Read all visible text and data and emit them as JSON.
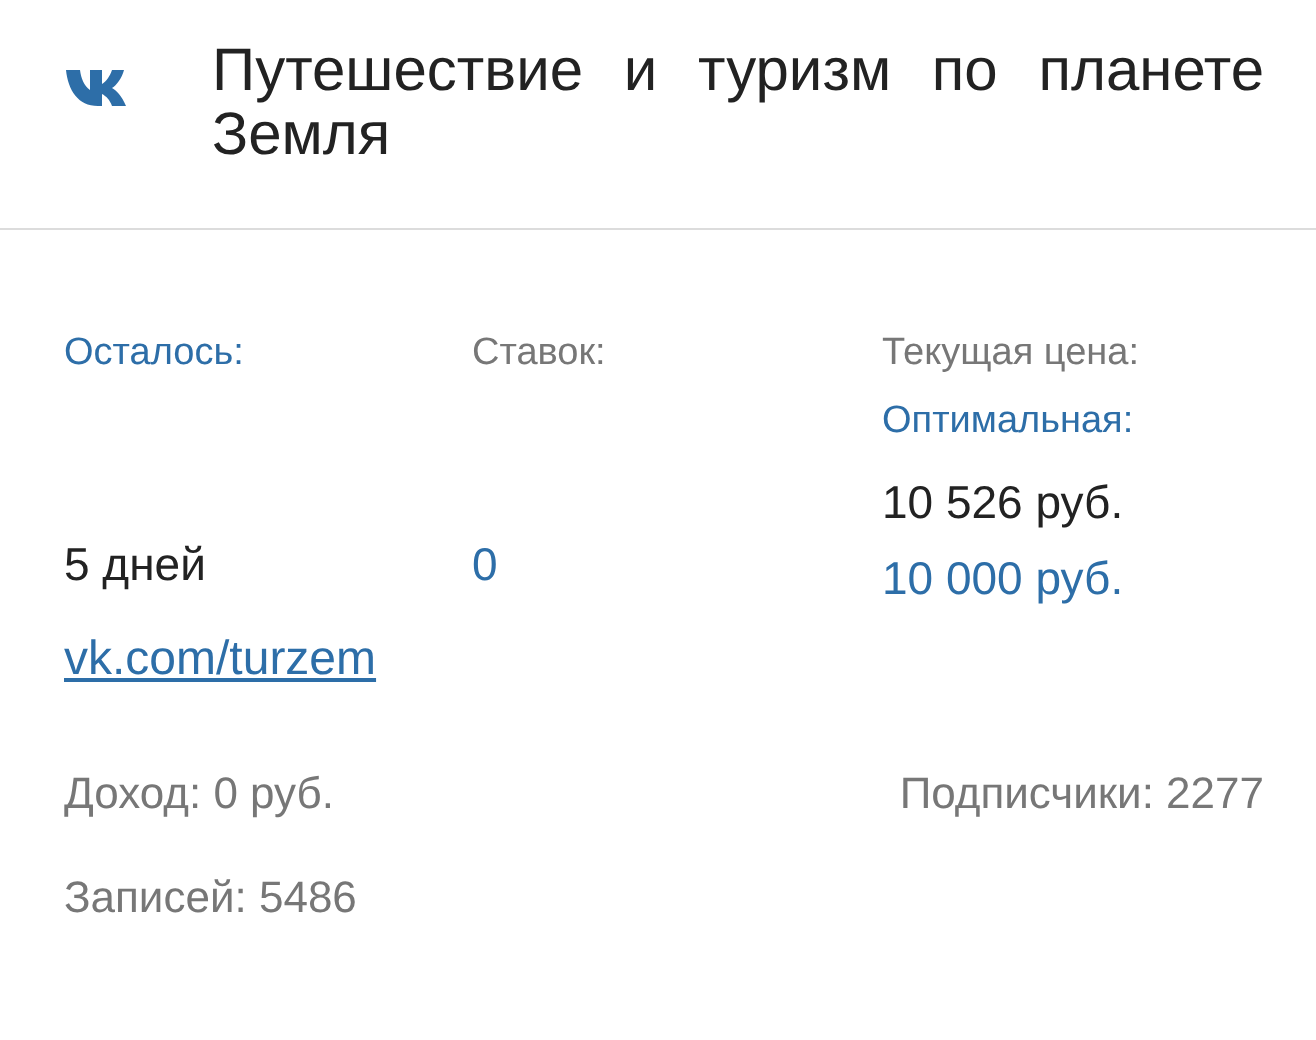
{
  "header": {
    "title": "Путешествие и туризм по планете Земля"
  },
  "remaining": {
    "label": "Осталось:",
    "value": "5 дней"
  },
  "bids": {
    "label": "Ставок:",
    "value": "0"
  },
  "price": {
    "current_label": "Текущая цена:",
    "optimal_label": "Оптимальная:",
    "current_value": "10 526 руб.",
    "optimal_value": "10 000 руб."
  },
  "link": "vk.com/turzem",
  "income": "Доход: 0 руб.",
  "subscribers": "Подписчики: 2277",
  "posts": "Записей: 5486"
}
